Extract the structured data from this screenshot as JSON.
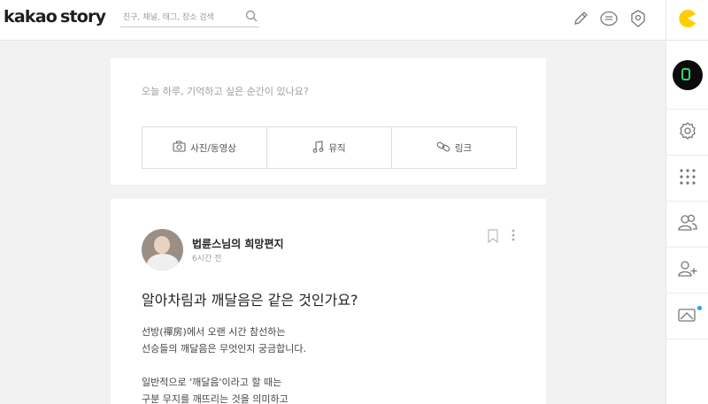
{
  "header": {
    "logo_left": "kakao",
    "logo_right": "story",
    "search_placeholder": "친구, 채널, 태그, 장소 검색",
    "icons": [
      "pencil-icon",
      "message-icon",
      "location-pin-icon",
      "pacman-icon"
    ]
  },
  "sidebar": {
    "icons": [
      "profile-avatar",
      "gear-icon",
      "grid-icon",
      "friends-icon",
      "add-friend-icon",
      "media-icon"
    ]
  },
  "compose": {
    "prompt": "오늘 하루, 기억하고 싶은 순간이 있나요?",
    "buttons": [
      {
        "label": "사진/동영상",
        "icon": "camera-icon"
      },
      {
        "label": "뮤직",
        "icon": "music-icon"
      },
      {
        "label": "링크",
        "icon": "link-icon"
      }
    ]
  },
  "post": {
    "author": "법륜스님의 희망편지",
    "time": "6시간 전",
    "title": "알아차림과 깨달음은 같은 것인가요?",
    "lines": [
      "선방(禪房)에서 오랜 시간 참선하는",
      "선승들의 깨달음은 무엇인지 궁금합니다.",
      "",
      "일반적으로 '깨달음'이라고 할 때는",
      "구분 무지를 깨뜨리는 것을 의미하고"
    ]
  },
  "colors": {
    "background": "#f2f2f2",
    "accent_yellow": "#ffcd00",
    "notification_dot": "#21a1ff"
  }
}
